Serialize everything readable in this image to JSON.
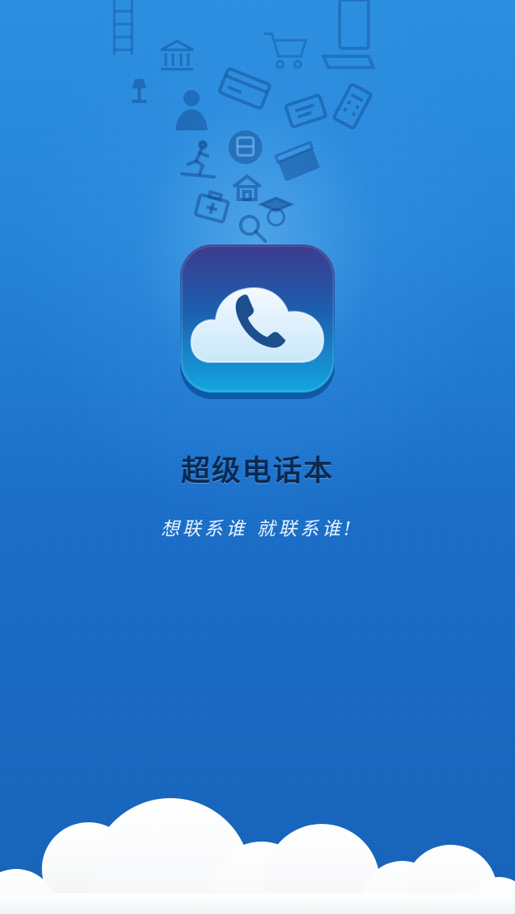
{
  "app": {
    "title": "超级电话本",
    "slogan": "想联系谁 就联系谁!"
  },
  "icons": {
    "app_icon": "cloud-phone-icon",
    "decorative": [
      "bank-icon",
      "lamp-icon",
      "cart-icon",
      "card-icon",
      "person-icon",
      "ticket-icon",
      "calculator-icon",
      "bus-icon",
      "runner-icon",
      "film-icon",
      "house-icon",
      "medical-kit-icon",
      "graduate-icon",
      "search-icon"
    ]
  },
  "colors": {
    "background_top": "#2a8ee0",
    "background_bottom": "#1662b9",
    "title": "#0b2a52",
    "slogan": "#eaf4ff"
  }
}
